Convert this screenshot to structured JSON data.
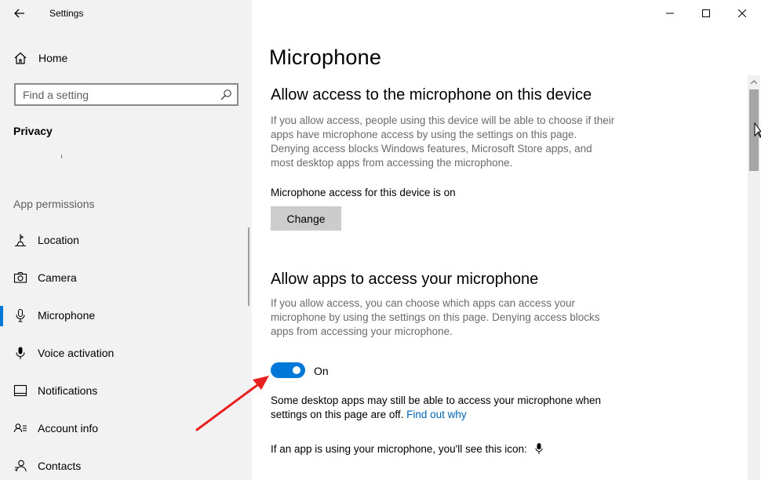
{
  "window": {
    "app_title": "Settings"
  },
  "sidebar": {
    "home_label": "Home",
    "search_placeholder": "Find a setting",
    "section_title": "Privacy",
    "group_label": "App permissions",
    "items": [
      {
        "label": "Location",
        "icon": "location-icon"
      },
      {
        "label": "Camera",
        "icon": "camera-icon"
      },
      {
        "label": "Microphone",
        "icon": "microphone-icon",
        "active": true
      },
      {
        "label": "Voice activation",
        "icon": "voice-activation-icon"
      },
      {
        "label": "Notifications",
        "icon": "notifications-icon"
      },
      {
        "label": "Account info",
        "icon": "account-info-icon"
      },
      {
        "label": "Contacts",
        "icon": "contacts-icon"
      }
    ]
  },
  "main": {
    "page_title": "Microphone",
    "device_section": {
      "heading": "Allow access to the microphone on this device",
      "description": "If you allow access, people using this device will be able to choose if their apps have microphone access by using the settings on this page. Denying access blocks Windows features, Microsoft Store apps, and most desktop apps from accessing the microphone.",
      "status": "Microphone access for this device is on",
      "change_button": "Change"
    },
    "apps_section": {
      "heading": "Allow apps to access your microphone",
      "description": "If you allow access, you can choose which apps can access your microphone by using the settings on this page. Denying access blocks apps from accessing your microphone.",
      "toggle_label": "On",
      "toggle_on": true,
      "note": "Some desktop apps may still be able to access your microphone when settings on this page are off.",
      "note_link": "Find out why",
      "icon_note": "If an app is using your microphone, you'll see this icon:"
    }
  },
  "colors": {
    "accent": "#0078d7",
    "link": "#0063b1",
    "annotation_arrow": "#e8201f"
  }
}
